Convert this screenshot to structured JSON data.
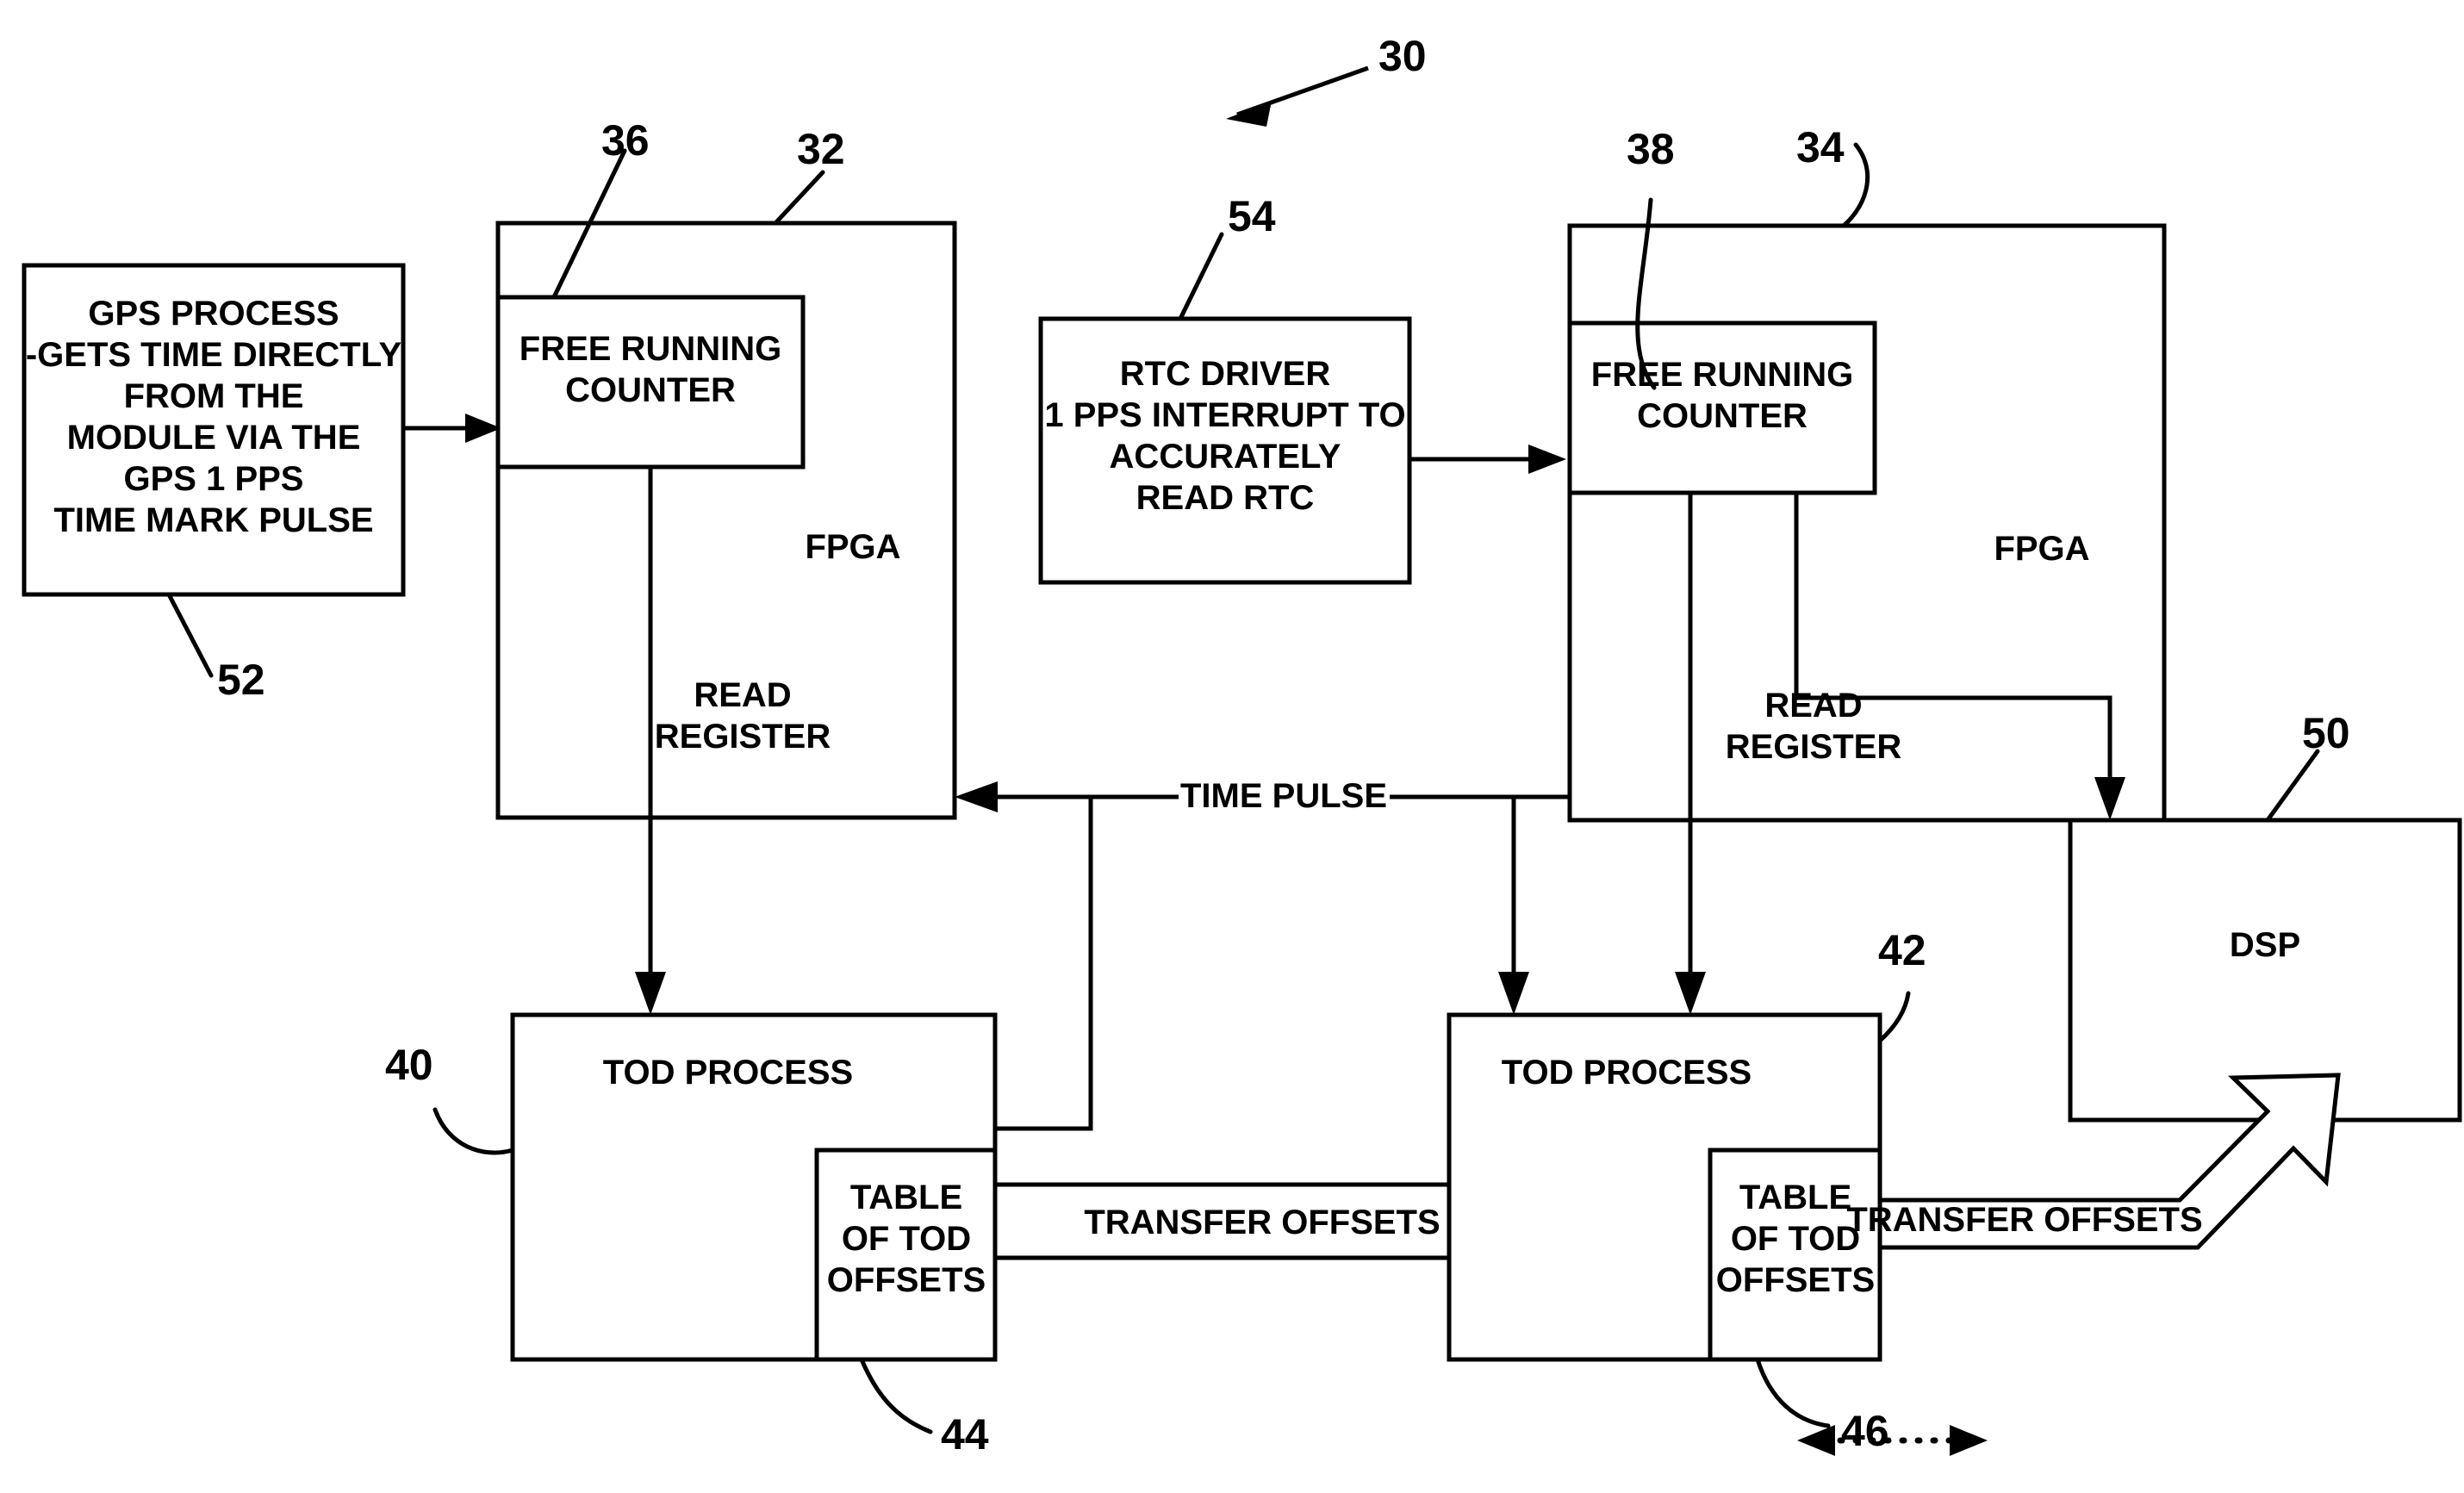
{
  "figure": {
    "title": "Time-of-day distribution block diagram",
    "system_ref": "30"
  },
  "blocks": {
    "gps_process": {
      "ref": "52",
      "lines": [
        "GPS PROCESS",
        "-GETS TIME DIRECTLY",
        "FROM THE",
        "MODULE VIA THE",
        "GPS 1 PPS",
        "TIME MARK PULSE"
      ]
    },
    "fpga_left": {
      "ref": "32",
      "label": "FPGA",
      "counter": {
        "ref": "36",
        "lines": [
          "FREE RUNNING",
          "COUNTER"
        ]
      },
      "read_register": {
        "lines": [
          "READ",
          "REGISTER"
        ]
      }
    },
    "rtc_driver": {
      "ref": "54",
      "lines": [
        "RTC DRIVER",
        "1 PPS INTERRUPT TO",
        "ACCURATELY",
        "READ RTC"
      ]
    },
    "fpga_right": {
      "ref": "34",
      "label": "FPGA",
      "counter": {
        "ref": "38",
        "lines": [
          "FREE RUNNING",
          "COUNTER"
        ]
      },
      "read_register": {
        "lines": [
          "READ",
          "REGISTER"
        ]
      }
    },
    "tod_process_left": {
      "ref": "40",
      "label": "TOD PROCESS",
      "table": {
        "ref": "44",
        "lines": [
          "TABLE",
          "OF TOD",
          "OFFSETS"
        ]
      }
    },
    "tod_process_right": {
      "ref": "42",
      "label": "TOD PROCESS",
      "table": {
        "ref": "46",
        "lines": [
          "TABLE",
          "OF TOD",
          "OFFSETS"
        ]
      }
    },
    "dsp": {
      "ref": "50",
      "label": "DSP"
    }
  },
  "connectors": {
    "time_pulse": "TIME PULSE",
    "transfer_offsets_1": "TRANSFER OFFSETS",
    "transfer_offsets_2": "TRANSFER OFFSETS"
  },
  "colors": {
    "ink": "#000000",
    "paper": "#ffffff"
  }
}
